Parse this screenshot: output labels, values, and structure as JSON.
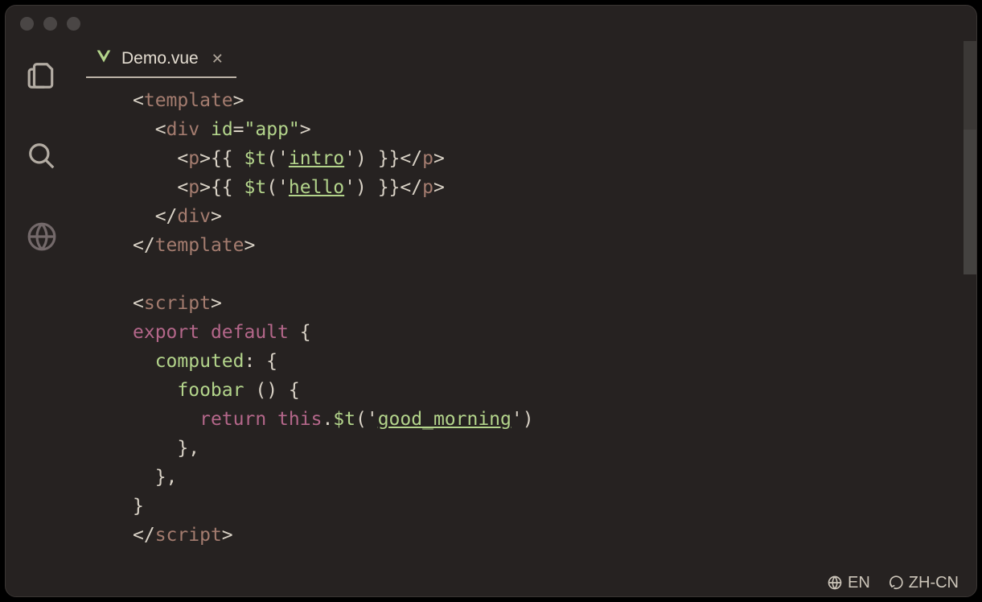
{
  "tab": {
    "filename": "Demo.vue"
  },
  "code": {
    "tag_template_open": "template",
    "tag_template_close": "template",
    "tag_div": "div",
    "attr_id": "id",
    "attr_id_value": "\"app\"",
    "tag_p": "p",
    "t_fn": "$t",
    "key_intro": "intro",
    "key_hello": "hello",
    "key_goodmorning": "good_morning",
    "tag_script_open": "script",
    "tag_script_close": "script",
    "kw_export": "export",
    "kw_default": "default",
    "kw_computed": "computed",
    "fn_foobar": "foobar",
    "kw_return": "return",
    "kw_this": "this"
  },
  "status": {
    "lang_primary": "EN",
    "lang_secondary": "ZH-CN"
  }
}
